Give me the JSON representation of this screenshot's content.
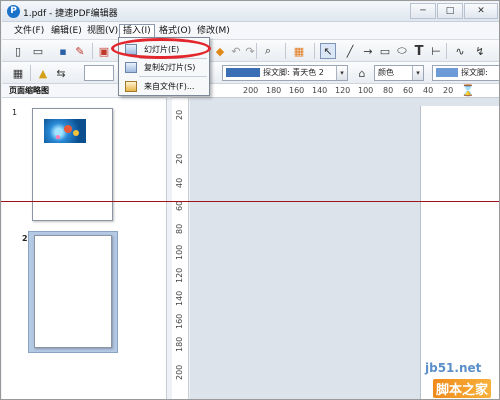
{
  "window": {
    "title": "1.pdf - 捷速PDF编辑器",
    "app_icon": "pdf-app-icon",
    "controls": [
      "─",
      "□",
      "✕"
    ]
  },
  "menubar": {
    "items": [
      {
        "label": "文件(F)"
      },
      {
        "label": "编辑(E)"
      },
      {
        "label": "视图(V)"
      },
      {
        "label": "插入(I)",
        "active": true
      },
      {
        "label": "格式(O)"
      },
      {
        "label": "修改(M)"
      }
    ]
  },
  "insert_menu": {
    "items": [
      {
        "label": "幻灯片(E)",
        "icon": "slide-icon"
      },
      {
        "label": "复制幻灯片(S)",
        "icon": "duplicate-slide-icon"
      },
      {
        "label": "来自文件(F)...",
        "icon": "file-icon"
      }
    ],
    "highlight_color": "#e2262c"
  },
  "toolbar2": {
    "line_style_value": "",
    "fill_label": "探文脚: 青天色 2",
    "fill_color": "#3b6fb5",
    "color_label": "颜色",
    "area_label": "探文脚:",
    "area_color": "#6c9bd8"
  },
  "ruler": {
    "h_ticks": [
      "200",
      "180",
      "160",
      "140",
      "120",
      "100",
      "80",
      "60",
      "40",
      "20",
      "0"
    ],
    "v_ticks": [
      "20",
      "20",
      "40",
      "60",
      "80",
      "100",
      "120",
      "140",
      "160",
      "180",
      "200"
    ]
  },
  "left_panel": {
    "title": "页面缩略图",
    "slides": [
      {
        "number": "1",
        "selected": false
      },
      {
        "number": "2",
        "selected": true
      }
    ]
  },
  "watermark": {
    "domain": "jb51.net",
    "site_name": "脚本之家"
  },
  "colors": {
    "accent": "#1a73c8",
    "selection": "#b3c9e4",
    "workspace": "#dde3ea"
  }
}
